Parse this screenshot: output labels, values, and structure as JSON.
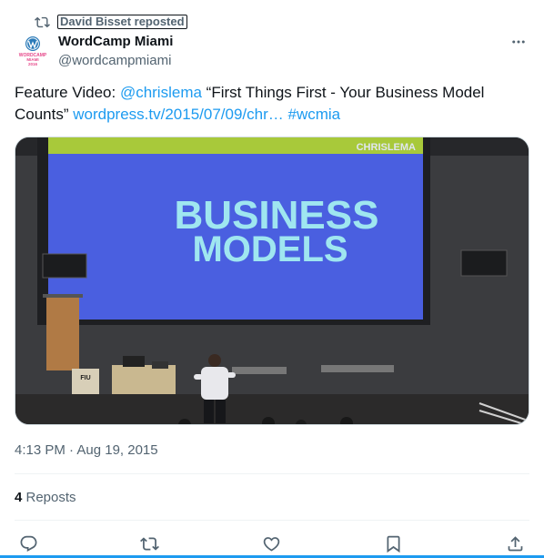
{
  "repost": {
    "label": "David Bisset reposted",
    "icon": "repost-icon"
  },
  "author": {
    "display_name": "WordCamp Miami",
    "handle": "@wordcampmiami",
    "avatar_icon": "wordcamp-miami-logo",
    "avatar_caption": "WORDCAMP MIAMI 2016"
  },
  "tweet": {
    "prefix": "Feature Video: ",
    "mention": "@chrislema",
    "quote_text": " “First Things First - Your Business Model Counts” ",
    "url": "wordpress.tv/2015/07/09/chr…",
    "space": " ",
    "hashtag": "#wcmia"
  },
  "media": {
    "screen_title_line1": "BUSINESS",
    "screen_title_line2": "MODELS",
    "screen_banner": "CHRISLEMA",
    "podium_label": "FIU"
  },
  "timestamp": "4:13 PM · Aug 19, 2015",
  "stats": {
    "reposts_count": "4",
    "reposts_label": " Reposts"
  },
  "actions": [
    "reply-icon",
    "repost-icon",
    "like-icon",
    "bookmark-icon",
    "share-icon"
  ],
  "colors": {
    "link": "#1d9bf0",
    "secondary_text": "#536471",
    "primary_text": "#0f1419",
    "screen_blue": "#4a5fe0",
    "screen_banner_green": "#a8c93a",
    "title_cyan": "#9fe6f0"
  }
}
